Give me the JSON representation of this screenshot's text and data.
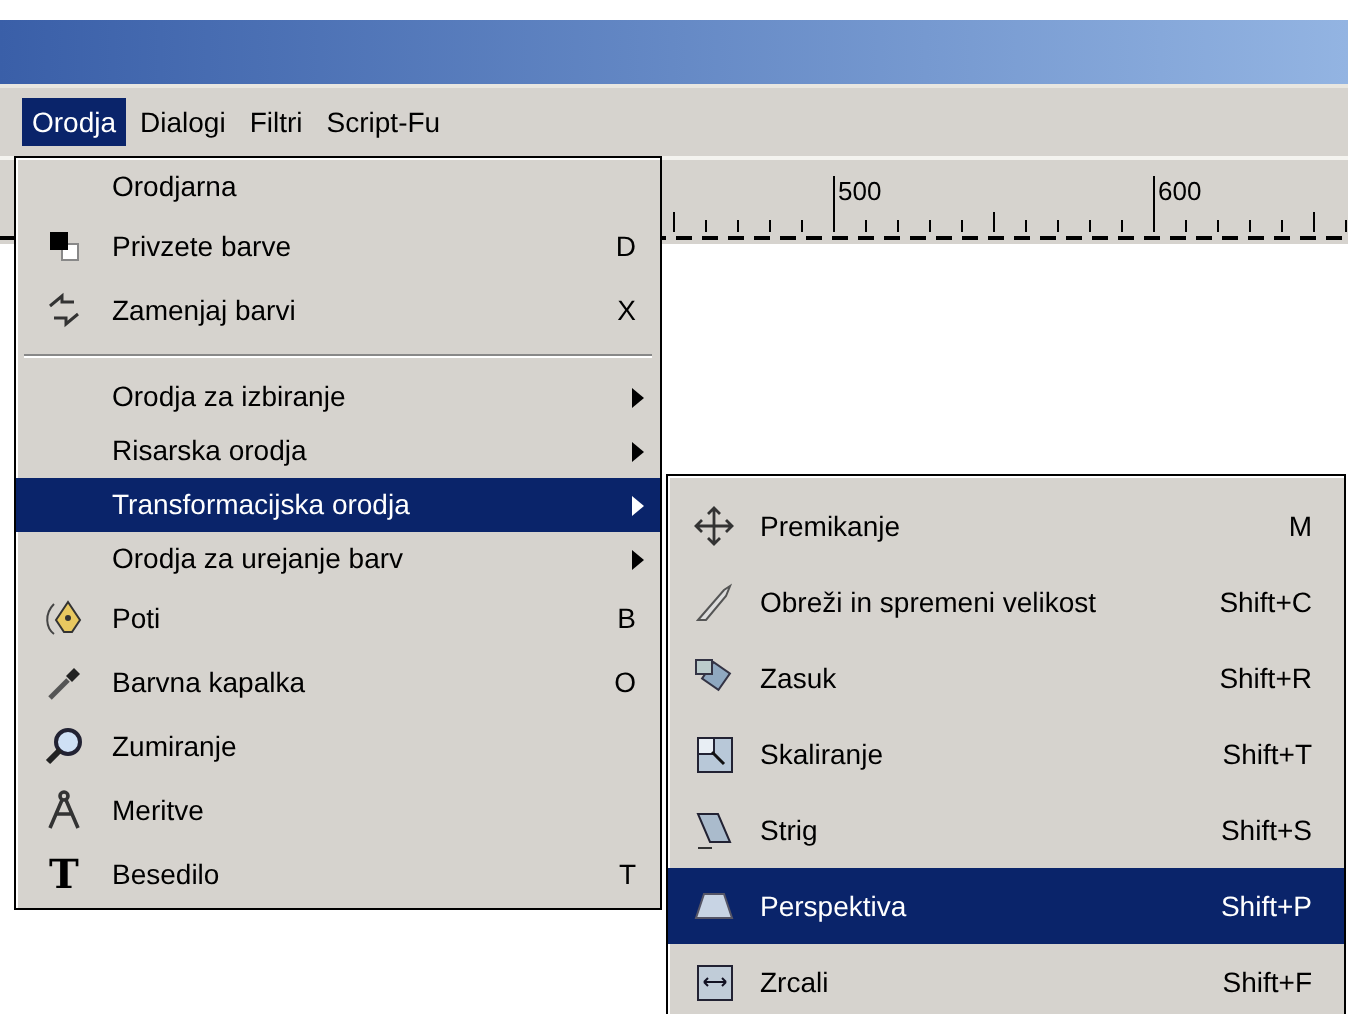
{
  "menubar": [
    {
      "label": "Orodja",
      "selected": true
    },
    {
      "label": "Dialogi",
      "selected": false
    },
    {
      "label": "Filtri",
      "selected": false
    },
    {
      "label": "Script-Fu",
      "selected": false
    }
  ],
  "ruler": {
    "labels": [
      "500",
      "600"
    ]
  },
  "menu": [
    {
      "kind": "item",
      "label": "Orodjarna",
      "selected": false
    },
    {
      "kind": "item",
      "label": "Privzete barve",
      "shortcut": "D",
      "selected": false
    },
    {
      "kind": "item",
      "label": "Zamenjaj barvi",
      "shortcut": "X",
      "selected": false
    },
    {
      "kind": "separator"
    },
    {
      "kind": "item",
      "label": "Orodja za izbiranje",
      "submenu": true,
      "selected": false
    },
    {
      "kind": "item",
      "label": "Risarska orodja",
      "submenu": true,
      "selected": false
    },
    {
      "kind": "item",
      "label": "Transformacijska orodja",
      "submenu": true,
      "selected": true
    },
    {
      "kind": "item",
      "label": "Orodja za urejanje barv",
      "submenu": true,
      "selected": false
    },
    {
      "kind": "item",
      "label": "Poti",
      "shortcut": "B",
      "selected": false
    },
    {
      "kind": "item",
      "label": "Barvna kapalka",
      "shortcut": "O",
      "selected": false
    },
    {
      "kind": "item",
      "label": "Zumiranje",
      "selected": false
    },
    {
      "kind": "item",
      "label": "Meritve",
      "selected": false
    },
    {
      "kind": "item",
      "label": "Besedilo",
      "shortcut": "T",
      "icon_text": "T",
      "selected": false
    }
  ],
  "submenu": [
    {
      "label": "Premikanje",
      "shortcut": "M",
      "selected": false
    },
    {
      "label": "Obreži in spremeni velikost",
      "shortcut": "Shift+C",
      "selected": false
    },
    {
      "label": "Zasuk",
      "shortcut": "Shift+R",
      "selected": false
    },
    {
      "label": "Skaliranje",
      "shortcut": "Shift+T",
      "selected": false
    },
    {
      "label": "Strig",
      "shortcut": "Shift+S",
      "selected": false
    },
    {
      "label": "Perspektiva",
      "shortcut": "Shift+P",
      "selected": true
    },
    {
      "label": "Zrcali",
      "shortcut": "Shift+F",
      "selected": false
    }
  ]
}
